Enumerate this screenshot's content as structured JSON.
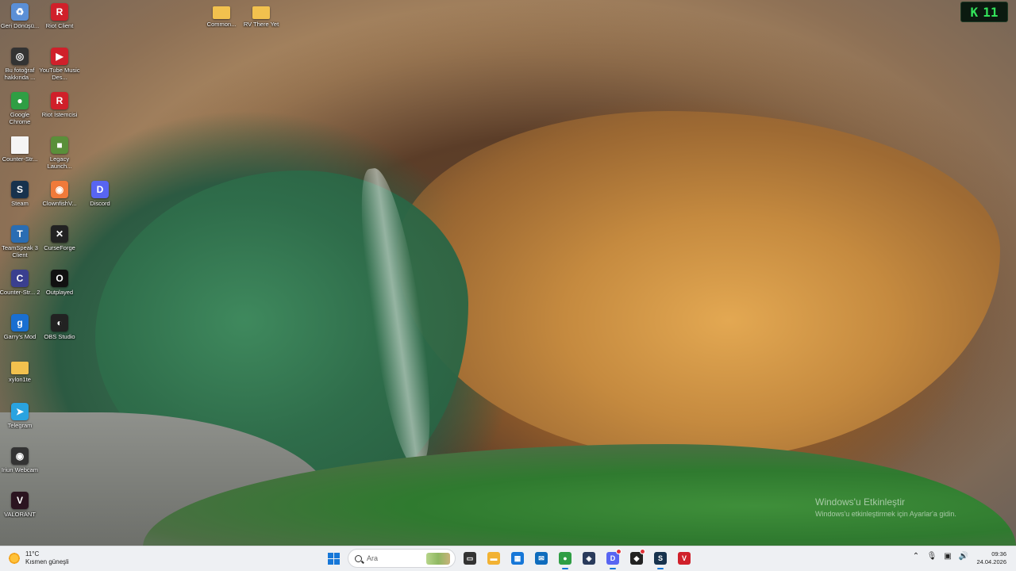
{
  "desktop": {
    "icons": [
      {
        "label": "Geri Dönüşü...",
        "icon": "recycle-bin-icon",
        "color": "#5b8fd6",
        "glyph": "♻"
      },
      {
        "label": "Riot Client",
        "icon": "riot-client-icon",
        "color": "#d0202a",
        "glyph": "R"
      },
      {
        "label": "Common...",
        "icon": "folder-icon",
        "color": "#f2c14e",
        "glyph": ""
      },
      {
        "label": "RV There Yet",
        "icon": "folder-icon",
        "color": "#f2c14e",
        "glyph": ""
      },
      {
        "label": "Bu fotoğraf hakkında ...",
        "icon": "camera-icon",
        "color": "#333333",
        "glyph": "◎"
      },
      {
        "label": "YouTube Music Des...",
        "icon": "youtube-music-icon",
        "color": "#d0202a",
        "glyph": "▶"
      },
      {
        "label": "Google Chrome",
        "icon": "chrome-icon",
        "color": "#2f9e44",
        "glyph": "●"
      },
      {
        "label": "Riot İstemcisi",
        "icon": "riot-client-icon",
        "color": "#d0202a",
        "glyph": "R"
      },
      {
        "label": "Counter-Str...",
        "icon": "file-icon",
        "color": "#f5f5f5",
        "glyph": ""
      },
      {
        "label": "Legacy Launch...",
        "icon": "minecraft-icon",
        "color": "#5a8f3a",
        "glyph": "■"
      },
      {
        "label": "Steam",
        "icon": "steam-icon",
        "color": "#17324d",
        "glyph": "S"
      },
      {
        "label": "ClownfishV...",
        "icon": "clownfish-icon",
        "color": "#f07a3a",
        "glyph": "◉"
      },
      {
        "label": "Discord",
        "icon": "discord-icon",
        "color": "#5865f2",
        "glyph": "D"
      },
      {
        "label": "TeamSpeak 3 Client",
        "icon": "teamspeak-icon",
        "color": "#2a6db3",
        "glyph": "T"
      },
      {
        "label": "CurseForge",
        "icon": "curseforge-icon",
        "color": "#222222",
        "glyph": "✕"
      },
      {
        "label": "Counter-Str... 2",
        "icon": "counter-strike-icon",
        "color": "#3a3f8f",
        "glyph": "C"
      },
      {
        "label": "Outplayed",
        "icon": "outplayed-icon",
        "color": "#111111",
        "glyph": "O"
      },
      {
        "label": "Garry's Mod",
        "icon": "garrys-mod-icon",
        "color": "#1a6fd0",
        "glyph": "g"
      },
      {
        "label": "OBS Studio",
        "icon": "obs-icon",
        "color": "#222222",
        "glyph": "◐"
      },
      {
        "label": "xylon1te",
        "icon": "folder-icon",
        "color": "#f2c14e",
        "glyph": ""
      },
      {
        "label": "Telegram",
        "icon": "telegram-icon",
        "color": "#2aa3e0",
        "glyph": "➤"
      },
      {
        "label": "Iriun Webcam",
        "icon": "webcam-icon",
        "color": "#333333",
        "glyph": "◉"
      },
      {
        "label": "VALORANT",
        "icon": "valorant-icon",
        "color": "#2b1420",
        "glyph": "V"
      }
    ]
  },
  "widget": {
    "icon": "k-logo-icon",
    "value": "11"
  },
  "watermark": {
    "title": "Windows'u Etkinleştir",
    "subtitle": "Windows'u etkinleştirmek için Ayarlar'a gidin."
  },
  "taskbar": {
    "weather": {
      "temp": "11°C",
      "condition": "Kısmen güneşli"
    },
    "search_placeholder": "Ara",
    "apps": [
      {
        "name": "task-view-icon",
        "color": "#333333",
        "glyph": "▭"
      },
      {
        "name": "file-explorer-icon",
        "color": "#f2b233",
        "glyph": "▬"
      },
      {
        "name": "store-icon",
        "color": "#1677d8",
        "glyph": "▦"
      },
      {
        "name": "outlook-icon",
        "color": "#0f6cbd",
        "glyph": "✉"
      },
      {
        "name": "chrome-icon",
        "color": "#2f9e44",
        "glyph": "●"
      },
      {
        "name": "app-icon",
        "color": "#2a3b5c",
        "glyph": "◈"
      },
      {
        "name": "discord-icon",
        "color": "#5865f2",
        "glyph": "D"
      },
      {
        "name": "app-icon",
        "color": "#222222",
        "glyph": "◆"
      },
      {
        "name": "steam-icon",
        "color": "#17324d",
        "glyph": "S"
      },
      {
        "name": "app-icon",
        "color": "#d0202a",
        "glyph": "V"
      }
    ],
    "clock": {
      "time": "09:36",
      "date": "24.04.2026"
    }
  }
}
